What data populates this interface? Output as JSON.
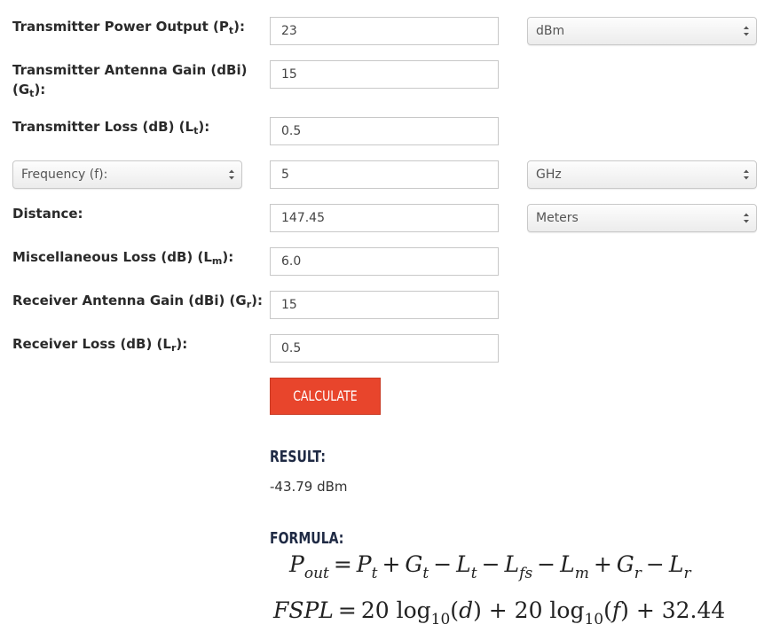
{
  "fields": {
    "tx_power": {
      "label_main": "Transmitter Power Output (P",
      "label_sub": "t",
      "label_end": "):",
      "value": "23",
      "unit": "dBm"
    },
    "tx_gain": {
      "label_line1": "Transmitter Antenna Gain (dBi)",
      "label_main": "(G",
      "label_sub": "t",
      "label_end": "):",
      "value": "15"
    },
    "tx_loss": {
      "label_main": "Transmitter Loss (dB) (L",
      "label_sub": "t",
      "label_end": "):",
      "value": "0.5"
    },
    "frequency": {
      "select_label": "Frequency (f):",
      "value": "5",
      "unit": "GHz"
    },
    "distance": {
      "label": "Distance:",
      "value": "147.45",
      "unit": "Meters"
    },
    "misc_loss": {
      "label_main": "Miscellaneous Loss (dB) (L",
      "label_sub": "m",
      "label_end": "):",
      "value": "6.0"
    },
    "rx_gain": {
      "label_main": "Receiver Antenna Gain (dBi) (G",
      "label_sub": "r",
      "label_end": "):",
      "value": "15"
    },
    "rx_loss": {
      "label_main": "Receiver Loss (dB) (L",
      "label_sub": "r",
      "label_end": "):",
      "value": "0.5"
    }
  },
  "actions": {
    "calculate_label": "CALCULATE"
  },
  "result": {
    "heading": "RESULT:",
    "value": "-43.79 dBm"
  },
  "formula": {
    "heading": "FORMULA:"
  },
  "colors": {
    "button": "#e8452c",
    "heading": "#1f2a44"
  }
}
